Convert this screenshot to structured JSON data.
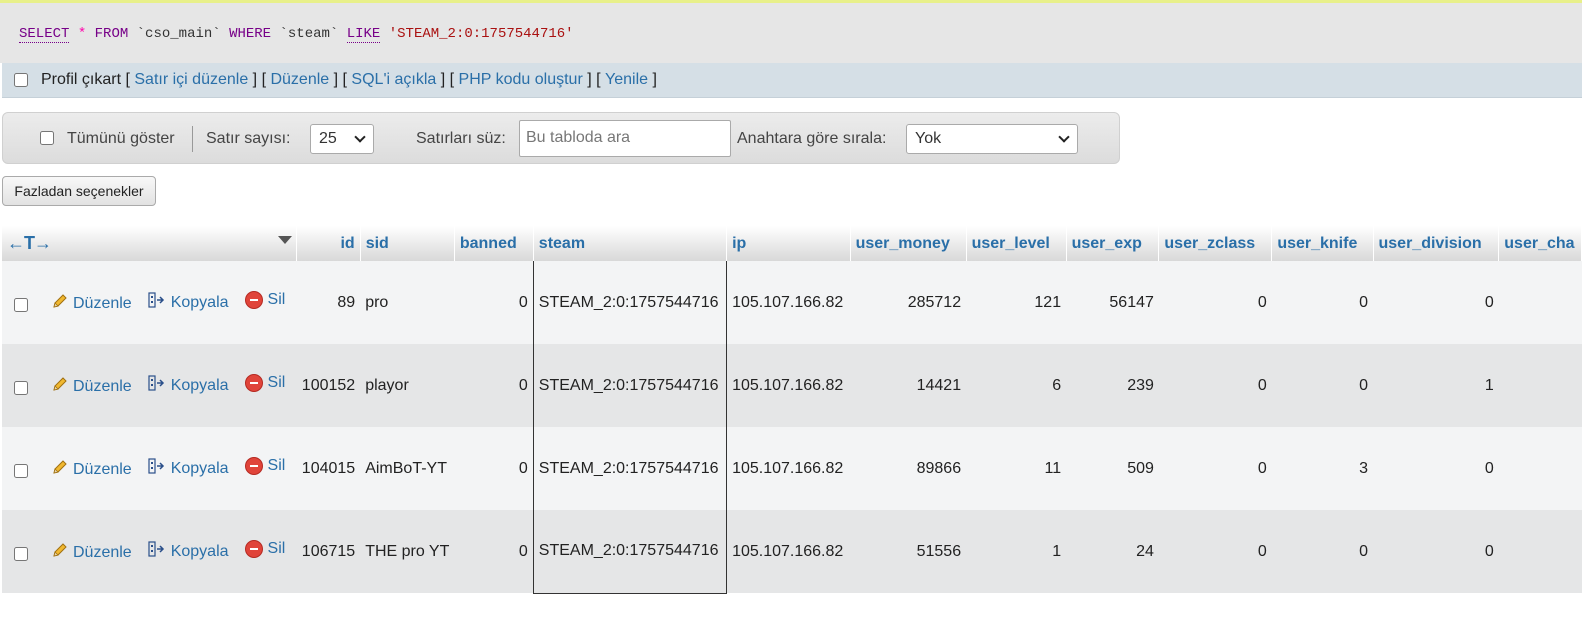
{
  "query": {
    "select": "SELECT",
    "star": "*",
    "from": "FROM",
    "table": "`cso_main`",
    "where": "WHERE",
    "column": "`steam`",
    "like": "LIKE",
    "value": "'STEAM_2:0:1757544716'"
  },
  "profile_bar": {
    "profile_label": "Profil çıkart",
    "open1": "[",
    "inline_edit": "Satır içi düzenle",
    "sep1": "] [",
    "edit": "Düzenle",
    "sep2": "] [",
    "explain": "SQL'i açıkla",
    "sep3": "] [",
    "php": "PHP kodu oluştur",
    "sep4": "] [",
    "refresh": "Yenile",
    "close": "]"
  },
  "nav": {
    "show_all": "Tümünü göster",
    "row_count_label": "Satır sayısı:",
    "row_count_value": "25",
    "filter_label": "Satırları süz:",
    "filter_placeholder": "Bu tabloda ara",
    "sort_label": "Anahtara göre sırala:",
    "sort_value": "Yok"
  },
  "more_options": "Fazladan seçenekler",
  "table": {
    "arrows": "←T→",
    "columns": [
      "id",
      "sid",
      "banned",
      "steam",
      "ip",
      "user_money",
      "user_level",
      "user_exp",
      "user_zclass",
      "user_knife",
      "user_division",
      "user_cha"
    ],
    "actions": {
      "edit": "Düzenle",
      "copy": "Kopyala",
      "delete": "Sil"
    },
    "rows": [
      {
        "id": "89",
        "sid": "pro",
        "banned": "0",
        "steam": "STEAM_2:0:1757544716",
        "ip": "105.107.166.82",
        "user_money": "285712",
        "user_level": "121",
        "user_exp": "56147",
        "user_zclass": "0",
        "user_knife": "0",
        "user_division": "0"
      },
      {
        "id": "100152",
        "sid": "playor",
        "banned": "0",
        "steam": "STEAM_2:0:1757544716",
        "ip": "105.107.166.82",
        "user_money": "14421",
        "user_level": "6",
        "user_exp": "239",
        "user_zclass": "0",
        "user_knife": "0",
        "user_division": "1"
      },
      {
        "id": "104015",
        "sid": "AimBoT-YT",
        "banned": "0",
        "steam": "STEAM_2:0:1757544716",
        "ip": "105.107.166.82",
        "user_money": "89866",
        "user_level": "11",
        "user_exp": "509",
        "user_zclass": "0",
        "user_knife": "3",
        "user_division": "0"
      },
      {
        "id": "106715",
        "sid": "THE pro YT",
        "banned": "0",
        "steam": "STEAM_2:0:1757544716",
        "ip": "105.107.166.82",
        "user_money": "51556",
        "user_level": "1",
        "user_exp": "24",
        "user_zclass": "0",
        "user_knife": "0",
        "user_division": "0"
      }
    ]
  }
}
